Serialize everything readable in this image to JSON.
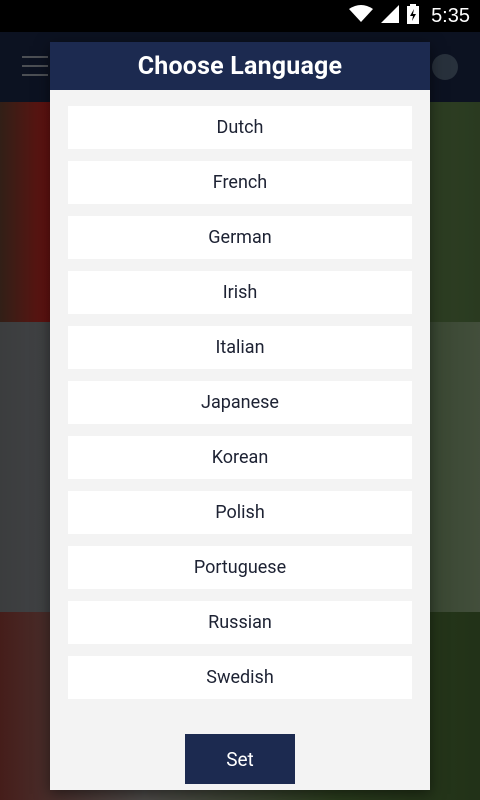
{
  "status_bar": {
    "time": "5:35",
    "icons": [
      "wifi-icon",
      "signal-icon",
      "battery-icon"
    ]
  },
  "app_bar": {
    "menu_icon": "hamburger-icon",
    "globe_icon": "globe-icon"
  },
  "dialog": {
    "title": "Choose Language",
    "languages": [
      "Dutch",
      "French",
      "German",
      "Irish",
      "Italian",
      "Japanese",
      "Korean",
      "Polish",
      "Portuguese",
      "Russian",
      "Swedish"
    ],
    "set_label": "Set"
  },
  "colors": {
    "header": "#1c2a50",
    "button": "#1c2a50",
    "dialog_bg": "#f3f3f3",
    "item_bg": "#ffffff"
  }
}
